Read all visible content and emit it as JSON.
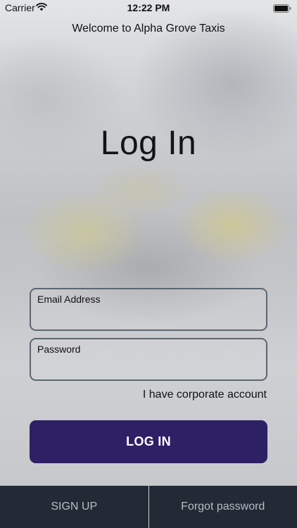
{
  "status_bar": {
    "carrier": "Carrier",
    "time": "12:22 PM"
  },
  "header": {
    "welcome": "Welcome to Alpha Grove Taxis"
  },
  "main": {
    "title": "Log In",
    "email_label": "Email Address",
    "email_value": "",
    "password_label": "Password",
    "password_value": "",
    "corporate_link": "I have corporate account",
    "login_button": "LOG IN"
  },
  "footer": {
    "sign_up": "SIGN UP",
    "forgot_password": "Forgot password"
  },
  "colors": {
    "login_button": "#2d2065",
    "bottom_bar": "#222a36",
    "field_border": "#5d6670"
  }
}
